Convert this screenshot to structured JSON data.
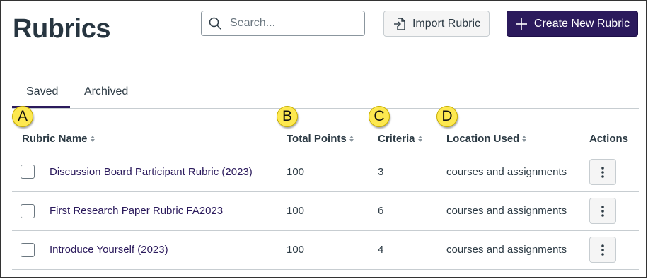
{
  "header": {
    "title": "Rubrics",
    "search_placeholder": "Search...",
    "import_label": "Import Rubric",
    "create_label": "Create New Rubric"
  },
  "tabs": [
    {
      "label": "Saved",
      "selected": true
    },
    {
      "label": "Archived",
      "selected": false
    }
  ],
  "markers": [
    "A",
    "B",
    "C",
    "D"
  ],
  "columns": {
    "name": "Rubric Name",
    "points": "Total Points",
    "criteria": "Criteria",
    "location": "Location Used",
    "actions": "Actions"
  },
  "rows": [
    {
      "name": "Discussion Board Participant Rubric (2023)",
      "points": "100",
      "criteria": "3",
      "location": "courses and assignments"
    },
    {
      "name": "First Research Paper Rubric FA2023",
      "points": "100",
      "criteria": "6",
      "location": "courses and assignments"
    },
    {
      "name": "Introduce Yourself (2023)",
      "points": "100",
      "criteria": "4",
      "location": "courses and assignments"
    }
  ],
  "icons": {
    "search": "search-icon",
    "import": "import-icon",
    "create": "plus-icon",
    "sort": "sort-icon",
    "actions": "kebab-menu-icon"
  },
  "colors": {
    "primary": "#2b1a5c",
    "marker": "#fde84f",
    "text": "#2d3b45"
  }
}
